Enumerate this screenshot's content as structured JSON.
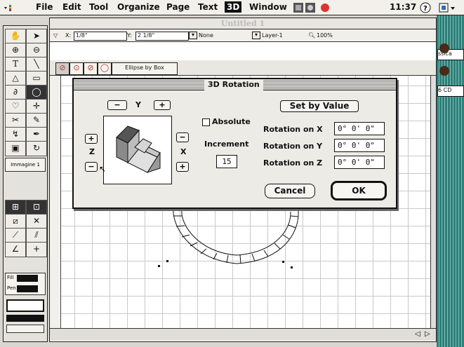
{
  "menubar": {
    "items": [
      "File",
      "Edit",
      "Tool",
      "Organize",
      "Page",
      "Text",
      "3D",
      "Window"
    ],
    "selected": "3D",
    "clock": "11:37"
  },
  "desktop": {
    "labels": [
      "ssica",
      "6 CD"
    ]
  },
  "palette": {
    "layer_label": "Immagine 1",
    "fill_label": "Fill",
    "pen_label": "Pen"
  },
  "document": {
    "title": "Untitled 1",
    "x_label": "X:",
    "x_value": "1/8\"",
    "y_label": "Y:",
    "y_value": "2 1/8\"",
    "fill_value": "None",
    "layer_value": "Layer-1",
    "zoom": "100%",
    "shape_mode": "Ellipse by Box"
  },
  "dialog": {
    "title": "3D Rotation",
    "y_axis_label": "Y",
    "x_axis_label": "X",
    "z_axis_label": "Z",
    "absolute_label": "Absolute",
    "absolute_checked": false,
    "increment_label": "Increment",
    "increment_value": "15",
    "set_by_value": "Set by Value",
    "rotation_x_label": "Rotation on X",
    "rotation_x_value": "0° 0' 0\"",
    "rotation_y_label": "Rotation on Y",
    "rotation_y_value": "0° 0' 0\"",
    "rotation_z_label": "Rotation on Z",
    "rotation_z_value": "0° 0' 0\"",
    "cancel": "Cancel",
    "ok": "OK",
    "minus": "−",
    "plus": "+"
  }
}
